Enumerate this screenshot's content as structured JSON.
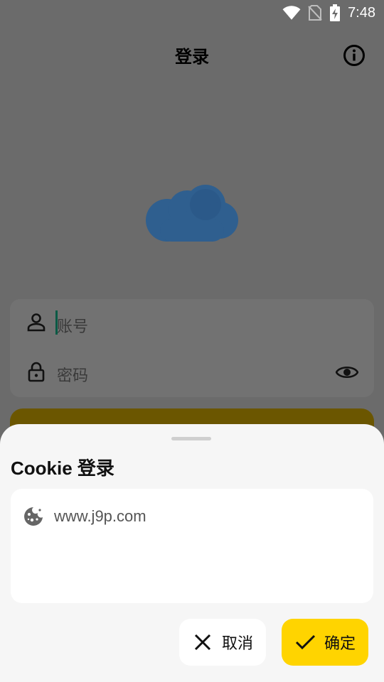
{
  "status_bar": {
    "time": "7:48",
    "icons": [
      "wifi-icon",
      "no-sim-icon",
      "battery-charging-icon"
    ]
  },
  "app_bar": {
    "title": "登录",
    "info_icon": "info-icon"
  },
  "login_form": {
    "account_placeholder": "账号",
    "password_placeholder": "密码",
    "account_icon": "person-icon",
    "password_icon": "lock-icon",
    "visibility_icon": "eye-icon"
  },
  "bottom_sheet": {
    "title": "Cookie 登录",
    "cookie_icon": "cookie-icon",
    "cookie_value": "www.j9p.com",
    "cancel_label": "取消",
    "confirm_label": "确定"
  },
  "colors": {
    "scrim": "#6b6b6b",
    "accent": "#ffd400",
    "logo": "#2f5f8f",
    "sheet_bg": "#f6f6f6"
  }
}
